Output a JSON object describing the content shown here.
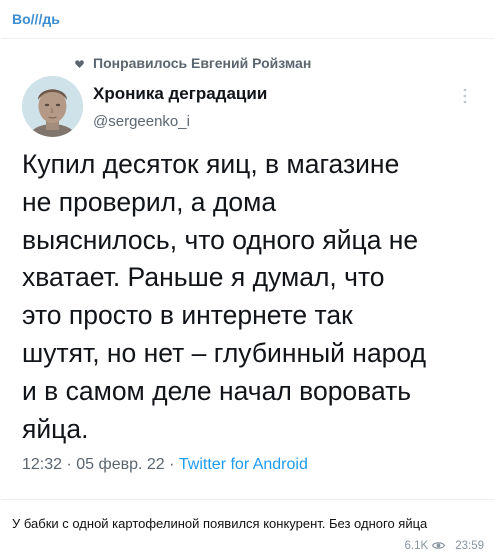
{
  "channel": {
    "name": "Во///дь"
  },
  "tweet": {
    "liked_by": "Понравилось Евгений Ройзман",
    "author": {
      "name": "Хроника деградации",
      "handle": "@sergeenko_i",
      "avatar_icon": "statue-portrait-avatar"
    },
    "text_lines": [
      "Купил десяток яиц, в магазине",
      "не проверил, а дома",
      "выяснилось, что одного яйца не",
      "хватает. Раньше я думал, что",
      "это просто в интернете так",
      "шутят, но нет – глубинный народ",
      "и в самом деле начал воровать",
      "яйца."
    ],
    "time": "12:32",
    "date": "05 февр. 22",
    "separator": "·",
    "source": "Twitter for Android"
  },
  "caption": "У бабки с одной картофелиной появился конкурент. Без одного яйца",
  "footer": {
    "views": "6.1K",
    "time": "23:59"
  },
  "colors": {
    "channel_name": "#3d8ed1",
    "link": "#1d9bf0",
    "muted": "#5b6670",
    "footer": "#8a969f"
  }
}
